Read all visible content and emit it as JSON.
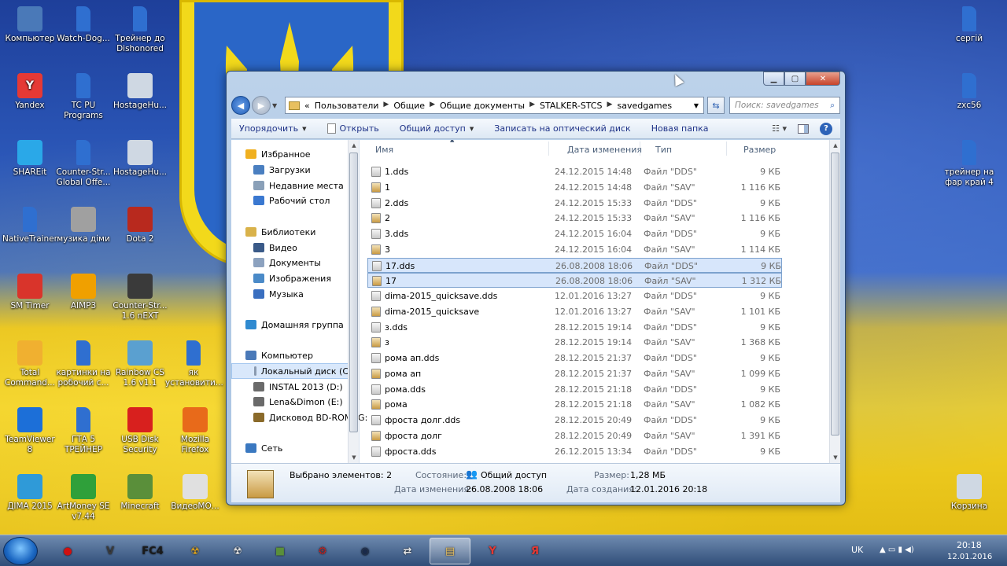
{
  "desktop": {
    "icons_left": [
      {
        "label": "Компьютер",
        "icon": "computer-icon",
        "color": "#4a79b8"
      },
      {
        "label": "Watch-Dog...",
        "icon": "folder-icon",
        "color": "#2f6fd0"
      },
      {
        "label": "Трейнер до Dishonored",
        "icon": "folder-icon",
        "color": "#2f6fd0"
      },
      {
        "label": "Yandex",
        "icon": "yandex-icon",
        "color": "#e53935",
        "glyph": "Y"
      },
      {
        "label": "TC PU Programs",
        "icon": "folder-icon",
        "color": "#2f6fd0"
      },
      {
        "label": "HostageHu...",
        "icon": "file-icon",
        "color": "#cfd8e3"
      },
      {
        "label": "SHAREit",
        "icon": "shareit-icon",
        "color": "#2aa8e8"
      },
      {
        "label": "Counter-Str... Global Offe...",
        "icon": "folder-icon",
        "color": "#2f6fd0"
      },
      {
        "label": "HostageHu...",
        "icon": "file-icon",
        "color": "#cfd8e3"
      },
      {
        "label": "NativeTrainer",
        "icon": "folder-icon",
        "color": "#2f6fd0"
      },
      {
        "label": "музика діми",
        "icon": "music-folder-icon",
        "color": "#a0a0a0"
      },
      {
        "label": "Dota 2",
        "icon": "dota-icon",
        "color": "#b8291e"
      },
      {
        "label": "SM Timer",
        "icon": "timer-icon",
        "color": "#d9342b"
      },
      {
        "label": "AIMP3",
        "icon": "aimp-icon",
        "color": "#f0a000"
      },
      {
        "label": "Counter-Str... 1.6 nEXT",
        "icon": "cs-icon",
        "color": "#3a3a3a"
      },
      {
        "label": "Total Command...",
        "icon": "total-commander-icon",
        "color": "#f0b030"
      },
      {
        "label": "картинки на робочий с...",
        "icon": "folder-icon",
        "color": "#2f6fd0"
      },
      {
        "label": "Rainbow CS 1.6 v1.1",
        "icon": "rainbow-icon",
        "color": "#5aa0d0"
      },
      {
        "label": "як установити...",
        "icon": "folder-icon",
        "color": "#2f6fd0"
      },
      {
        "label": "TeamViewer 8",
        "icon": "teamviewer-icon",
        "color": "#1c6fd8"
      },
      {
        "label": "ГТА 5 ТРЕЙНЕР",
        "icon": "folder-icon",
        "color": "#2f6fd0"
      },
      {
        "label": "USB Disk Security",
        "icon": "usb-security-icon",
        "color": "#d8201e"
      },
      {
        "label": "Mozilla Firefox",
        "icon": "firefox-icon",
        "color": "#e86a1a"
      },
      {
        "label": "ДІМА 2015",
        "icon": "windows-icon",
        "color": "#2f9ad8"
      },
      {
        "label": "ArtMoney SE v7.44",
        "icon": "artmoney-icon",
        "color": "#2fa03a"
      },
      {
        "label": "Minecraft",
        "icon": "minecraft-icon",
        "color": "#5a8f3a"
      },
      {
        "label": "ВидеоМО...",
        "icon": "video-icon",
        "color": "#e0e0e0"
      }
    ],
    "icons_right": [
      {
        "label": "сергій",
        "icon": "folder-icon",
        "color": "#2f6fd0"
      },
      {
        "label": "zxc56",
        "icon": "folder-icon",
        "color": "#2f6fd0"
      },
      {
        "label": "трейнер на фар край 4",
        "icon": "folder-icon",
        "color": "#2f6fd0"
      },
      {
        "label": "Корзина",
        "icon": "recycle-bin-icon",
        "color": "#cfd8e3"
      }
    ]
  },
  "explorer": {
    "back_icon": "back-arrow-icon",
    "address": {
      "prefix": "«",
      "segments": [
        "Пользователи",
        "Общие",
        "Общие документы",
        "STALKER-STCS",
        "savedgames"
      ]
    },
    "search_placeholder": "Поиск: savedgames",
    "toolbar": {
      "organize": "Упорядочить",
      "open": "Открыть",
      "share": "Общий доступ",
      "burn": "Записать на оптический диск",
      "new_folder": "Новая папка"
    },
    "nav": [
      {
        "label": "Избранное",
        "icon": "star-icon",
        "color": "#f0b020",
        "indent": 0
      },
      {
        "label": "Загрузки",
        "icon": "downloads-icon",
        "color": "#4a7fc0",
        "indent": 1
      },
      {
        "label": "Недавние места",
        "icon": "recent-places-icon",
        "color": "#8aa0b8",
        "indent": 1
      },
      {
        "label": "Рабочий стол",
        "icon": "desktop-icon",
        "color": "#3a78d0",
        "indent": 1
      },
      {
        "label": "Библиотеки",
        "icon": "libraries-icon",
        "color": "#d9b24a",
        "indent": 0
      },
      {
        "label": "Видео",
        "icon": "video-lib-icon",
        "color": "#3a5a88",
        "indent": 1
      },
      {
        "label": "Документы",
        "icon": "documents-icon",
        "color": "#8ca2bf",
        "indent": 1
      },
      {
        "label": "Изображения",
        "icon": "images-icon",
        "color": "#4a8ac8",
        "indent": 1
      },
      {
        "label": "Музыка",
        "icon": "music-icon",
        "color": "#3a6fc0",
        "indent": 1
      },
      {
        "label": "Домашняя группа",
        "icon": "homegroup-icon",
        "color": "#2f8ad0",
        "indent": 0
      },
      {
        "label": "Компьютер",
        "icon": "computer-icon",
        "color": "#4a79b8",
        "indent": 0
      },
      {
        "label": "Локальный диск (C:)",
        "icon": "hdd-icon",
        "color": "#8a9ab0",
        "indent": 1,
        "selected": true
      },
      {
        "label": "INSTAL 2013 (D:)",
        "icon": "optical-drive-icon",
        "color": "#6a6a6a",
        "indent": 1
      },
      {
        "label": "Lena&Dimon (E:)",
        "icon": "usb-drive-icon",
        "color": "#6a6a6a",
        "indent": 1
      },
      {
        "label": "Дисковод BD-ROM (G:",
        "icon": "bd-rom-icon",
        "color": "#8a6a2a",
        "indent": 1
      },
      {
        "label": "Сеть",
        "icon": "network-icon",
        "color": "#3a78c0",
        "indent": 0
      }
    ],
    "columns": {
      "name": "Имя",
      "date": "Дата изменения",
      "type": "Тип",
      "size": "Размер"
    },
    "files": [
      {
        "name": "1.dds",
        "date": "24.12.2015 14:48",
        "type": "Файл \"DDS\"",
        "size": "9 КБ",
        "kind": "dds"
      },
      {
        "name": "1",
        "date": "24.12.2015 14:48",
        "type": "Файл \"SAV\"",
        "size": "1 116 КБ",
        "kind": "sav"
      },
      {
        "name": "2.dds",
        "date": "24.12.2015 15:33",
        "type": "Файл \"DDS\"",
        "size": "9 КБ",
        "kind": "dds"
      },
      {
        "name": "2",
        "date": "24.12.2015 15:33",
        "type": "Файл \"SAV\"",
        "size": "1 116 КБ",
        "kind": "sav"
      },
      {
        "name": "3.dds",
        "date": "24.12.2015 16:04",
        "type": "Файл \"DDS\"",
        "size": "9 КБ",
        "kind": "dds"
      },
      {
        "name": "3",
        "date": "24.12.2015 16:04",
        "type": "Файл \"SAV\"",
        "size": "1 114 КБ",
        "kind": "sav"
      },
      {
        "name": "17.dds",
        "date": "26.08.2008 18:06",
        "type": "Файл \"DDS\"",
        "size": "9 КБ",
        "kind": "dds",
        "selected": true
      },
      {
        "name": "17",
        "date": "26.08.2008 18:06",
        "type": "Файл \"SAV\"",
        "size": "1 312 КБ",
        "kind": "sav",
        "selected": true
      },
      {
        "name": "dima-2015_quicksave.dds",
        "date": "12.01.2016 13:27",
        "type": "Файл \"DDS\"",
        "size": "9 КБ",
        "kind": "dds"
      },
      {
        "name": "dima-2015_quicksave",
        "date": "12.01.2016 13:27",
        "type": "Файл \"SAV\"",
        "size": "1 101 КБ",
        "kind": "sav"
      },
      {
        "name": "з.dds",
        "date": "28.12.2015 19:14",
        "type": "Файл \"DDS\"",
        "size": "9 КБ",
        "kind": "dds"
      },
      {
        "name": "з",
        "date": "28.12.2015 19:14",
        "type": "Файл \"SAV\"",
        "size": "1 368 КБ",
        "kind": "sav"
      },
      {
        "name": "рома ап.dds",
        "date": "28.12.2015 21:37",
        "type": "Файл \"DDS\"",
        "size": "9 КБ",
        "kind": "dds"
      },
      {
        "name": "рома ап",
        "date": "28.12.2015 21:37",
        "type": "Файл \"SAV\"",
        "size": "1 099 КБ",
        "kind": "sav"
      },
      {
        "name": "рома.dds",
        "date": "28.12.2015 21:18",
        "type": "Файл \"DDS\"",
        "size": "9 КБ",
        "kind": "dds"
      },
      {
        "name": "рома",
        "date": "28.12.2015 21:18",
        "type": "Файл \"SAV\"",
        "size": "1 082 КБ",
        "kind": "sav"
      },
      {
        "name": "фроста долг.dds",
        "date": "28.12.2015 20:49",
        "type": "Файл \"DDS\"",
        "size": "9 КБ",
        "kind": "dds"
      },
      {
        "name": "фроста долг",
        "date": "28.12.2015 20:49",
        "type": "Файл \"SAV\"",
        "size": "1 391 КБ",
        "kind": "sav"
      },
      {
        "name": "фроста.dds",
        "date": "26.12.2015 13:34",
        "type": "Файл \"DDS\"",
        "size": "9 КБ",
        "kind": "dds"
      }
    ],
    "details": {
      "selected_label": "Выбрано элементов: 2",
      "state_label": "Состояние:",
      "state_value": "Общий доступ",
      "size_label": "Размер:",
      "size_value": "1,28 МБ",
      "modified_label": "Дата изменения:",
      "modified_value": "26.08.2008 18:06",
      "created_label": "Дата создания:",
      "created_value": "12.01.2016 20:18"
    }
  },
  "taskbar": {
    "apps": [
      {
        "name": "record-app",
        "icon": "record-icon",
        "color": "#d01010",
        "glyph": "●"
      },
      {
        "name": "gta-v",
        "icon": "gta-icon",
        "color": "#3a3a3a",
        "glyph": "V"
      },
      {
        "name": "far-cry-4",
        "icon": "fc4-icon",
        "color": "#1a1a1a",
        "glyph": "FC4"
      },
      {
        "name": "stalker",
        "icon": "radiation-icon",
        "color": "#d8a020",
        "glyph": "☢"
      },
      {
        "name": "stalker-2",
        "icon": "radiation-dark-icon",
        "color": "#e0e0e0",
        "glyph": "☢"
      },
      {
        "name": "minecraft",
        "icon": "minecraft-icon",
        "color": "#5a8f3a",
        "glyph": "■"
      },
      {
        "name": "gear-app",
        "icon": "gear-icon",
        "color": "#c02020",
        "glyph": "⚙"
      },
      {
        "name": "steam",
        "icon": "steam-icon",
        "color": "#1a2a4a",
        "glyph": "◉"
      },
      {
        "name": "teamviewer",
        "icon": "arrows-icon",
        "color": "#e8e8e8",
        "glyph": "⇄"
      },
      {
        "name": "explorer",
        "icon": "explorer-folder-icon",
        "color": "#e8c060",
        "glyph": "▤",
        "active": true
      },
      {
        "name": "yandex-browser",
        "icon": "yandex-icon",
        "color": "#e53935",
        "glyph": "Y"
      },
      {
        "name": "yandex",
        "icon": "yandex-ya-icon",
        "color": "#e53935",
        "glyph": "Я"
      }
    ],
    "lang": "UK",
    "time": "20:18",
    "date": "12.01.2016"
  }
}
